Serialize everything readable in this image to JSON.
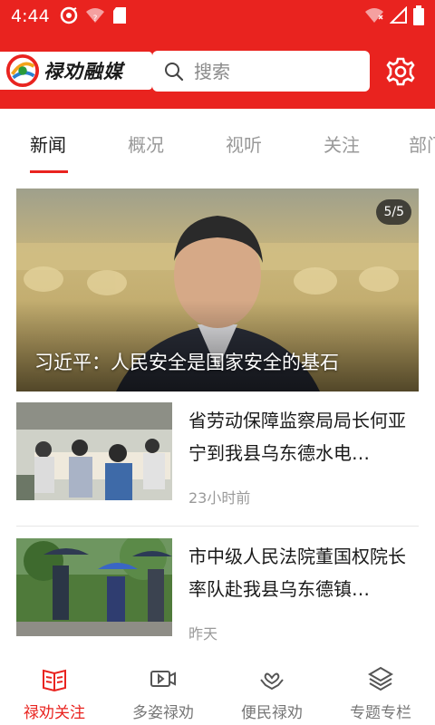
{
  "status_bar": {
    "time": "4:44",
    "icons": [
      "sync-icon",
      "wifi-question-icon",
      "sd-card-icon",
      "wifi-signal-icon",
      "cell-signal-icon",
      "battery-icon"
    ]
  },
  "header": {
    "logo_text": "禄劝融媒",
    "search_placeholder": "搜索",
    "accent_color": "#e9231f"
  },
  "tabs": [
    {
      "label": "新闻",
      "active": true
    },
    {
      "label": "概况",
      "active": false
    },
    {
      "label": "视听",
      "active": false
    },
    {
      "label": "关注",
      "active": false
    },
    {
      "label": "部门",
      "active": false
    }
  ],
  "hero": {
    "counter": "5/5",
    "caption": "习近平：人民安全是国家安全的基石"
  },
  "news": [
    {
      "title": "省劳动保障监察局局长何亚宁到我县乌东德水电…",
      "time": "23小时前"
    },
    {
      "title": "市中级人民法院董国权院长率队赴我县乌东德镇…",
      "time": "昨天"
    }
  ],
  "bottom_nav": [
    {
      "label": "禄劝关注",
      "icon": "book-icon",
      "active": true
    },
    {
      "label": "多姿禄劝",
      "icon": "video-icon",
      "active": false
    },
    {
      "label": "便民禄劝",
      "icon": "heart-hands-icon",
      "active": false
    },
    {
      "label": "专题专栏",
      "icon": "layers-icon",
      "active": false
    }
  ]
}
